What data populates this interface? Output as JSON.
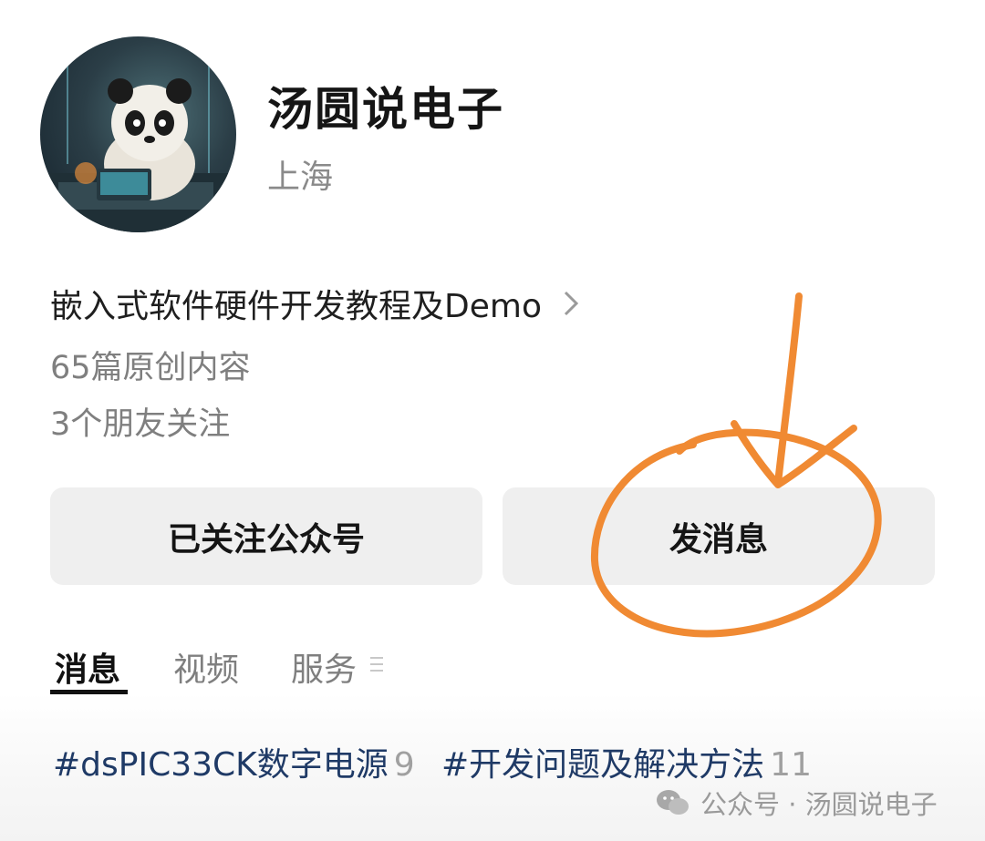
{
  "profile": {
    "name": "汤圆说电子",
    "location": "上海",
    "intro": "嵌入式软件硬件开发教程及Demo",
    "original_count": "65篇原创内容",
    "friends_following": "3个朋友关注"
  },
  "actions": {
    "follow_label": "已关注公众号",
    "message_label": "发消息"
  },
  "tabs": [
    {
      "label": "消息",
      "active": true
    },
    {
      "label": "视频",
      "active": false
    },
    {
      "label": "服务",
      "active": false
    }
  ],
  "topics": [
    {
      "label": "#dsPIC33CK数字电源",
      "count": "9"
    },
    {
      "label": "#开发问题及解决方法",
      "count": "11"
    }
  ],
  "watermark": "公众号 · 汤圆说电子",
  "colors": {
    "annotation": "#f08a33",
    "topic": "#1f3a66",
    "button_bg": "#efefef"
  },
  "icons": [
    "avatar",
    "chevron-right-icon",
    "more-icon",
    "wechat-icon"
  ]
}
